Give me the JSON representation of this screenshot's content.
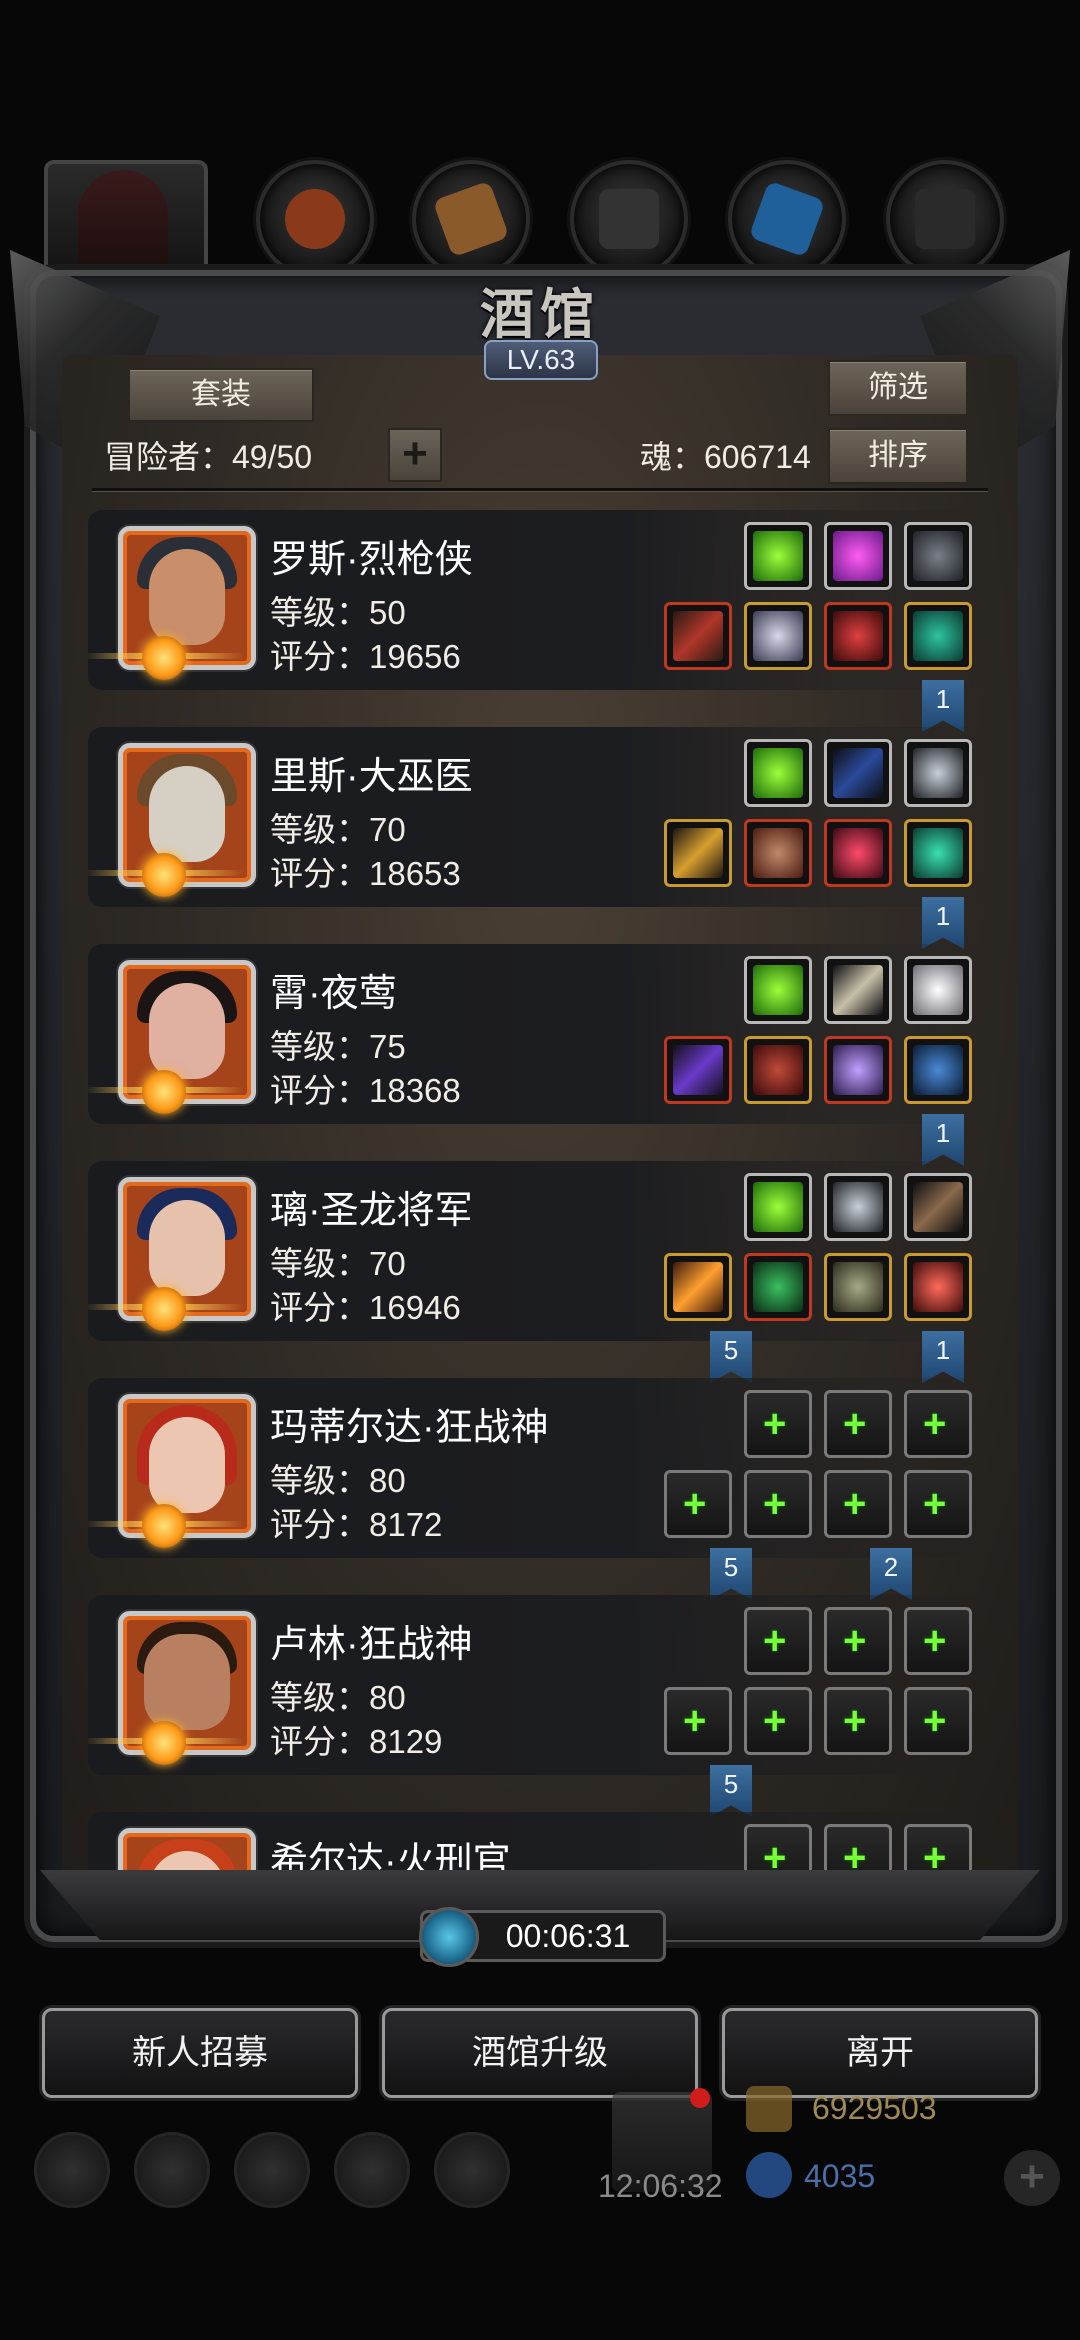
{
  "tavern": {
    "title": "酒馆",
    "level": "LV.63",
    "suit_label": "套装",
    "filter_label": "筛选",
    "sort_label": "排序",
    "adventurer_label": "冒险者：49/50",
    "add_label": "+",
    "soul_label": "魂：606714"
  },
  "heroes": [
    {
      "name": "罗斯·烈枪侠",
      "level": "等级：50",
      "score": "评分：19656",
      "flag_right": "1"
    },
    {
      "name": "里斯·大巫医",
      "level": "等级：70",
      "score": "评分：18653",
      "flag_right": "1"
    },
    {
      "name": "霄·夜莺",
      "level": "等级：75",
      "score": "评分：18368",
      "flag_right": "1"
    },
    {
      "name": "璃·圣龙将军",
      "level": "等级：70",
      "score": "评分：16946",
      "flag_left": "5",
      "flag_right": "1"
    },
    {
      "name": "玛蒂尔达·狂战神",
      "level": "等级：80",
      "score": "评分：8172",
      "flag_left": "5",
      "flag_right": "2"
    },
    {
      "name": "卢林·狂战神",
      "level": "等级：80",
      "score": "评分：8129",
      "flag_left": "5"
    },
    {
      "name": "希尔达·火刑官"
    }
  ],
  "timer": "00:06:31",
  "buttons": {
    "recruit": "新人招募",
    "upgrade": "酒馆升级",
    "leave": "离开"
  },
  "background": {
    "clock": "12:06:32",
    "gold": "6929503",
    "gems": "4035",
    "plus": "+"
  },
  "colors": {
    "accent_green": "#77ff3a",
    "flag_blue": "#2f5d8c",
    "frame_orange": "#e36a1d"
  }
}
